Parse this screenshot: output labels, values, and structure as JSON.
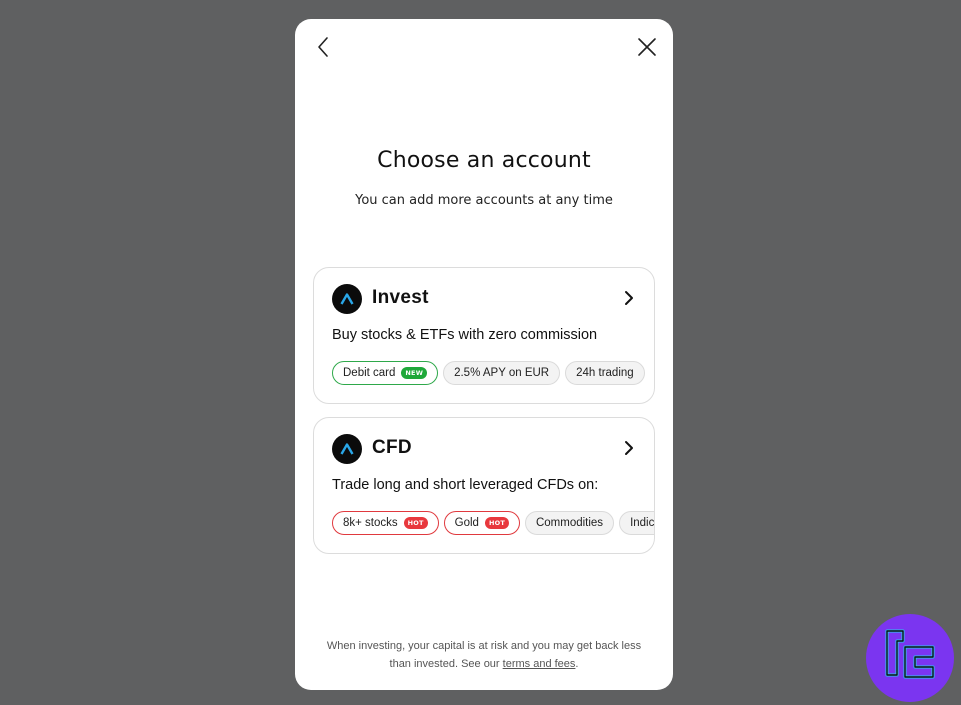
{
  "dialog": {
    "title": "Choose an account",
    "subtitle": "You can add more accounts at any time",
    "back_icon": "chevron-left-icon",
    "close_icon": "close-icon"
  },
  "accounts": [
    {
      "name": "Invest",
      "description": "Buy stocks & ETFs with zero commission",
      "chips": [
        {
          "label": "Debit card",
          "badge": "NEW",
          "style": "green"
        },
        {
          "label": "2.5% APY on EUR",
          "badge": "",
          "style": "default"
        },
        {
          "label": "24h trading",
          "badge": "",
          "style": "default"
        }
      ]
    },
    {
      "name": "CFD",
      "description": "Trade long and short leveraged CFDs on:",
      "chips": [
        {
          "label": "8k+ stocks",
          "badge": "HOT",
          "style": "red"
        },
        {
          "label": "Gold",
          "badge": "HOT",
          "style": "red"
        },
        {
          "label": "Commodities",
          "badge": "",
          "style": "default"
        },
        {
          "label": "Indic",
          "badge": "",
          "style": "default"
        }
      ]
    }
  ],
  "footer": {
    "disclaimer_text": "When investing, your capital is at risk and you may get back less than invested. See our",
    "link_text": "terms and fees",
    "end": "."
  },
  "colors": {
    "backdrop": "#5f6061",
    "new_badge": "#1fa83a",
    "hot_badge": "#e8383d",
    "logo_accent": "#2aa7e8",
    "watermark": "#7b35f0"
  }
}
